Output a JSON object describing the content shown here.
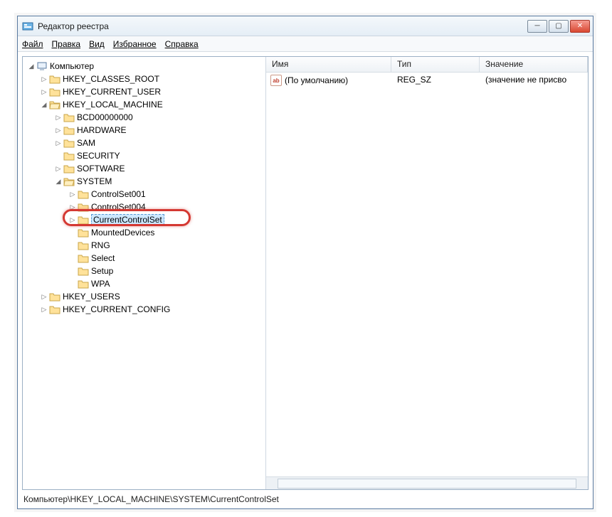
{
  "window": {
    "title": "Редактор реестра"
  },
  "menu": {
    "file": "Файл",
    "edit": "Правка",
    "view": "Вид",
    "favorites": "Избранное",
    "help": "Справка"
  },
  "tree": {
    "root": "Компьютер",
    "hkcr": "HKEY_CLASSES_ROOT",
    "hkcu": "HKEY_CURRENT_USER",
    "hklm": "HKEY_LOCAL_MACHINE",
    "hklm_children": {
      "bcd": "BCD00000000",
      "hardware": "HARDWARE",
      "sam": "SAM",
      "security": "SECURITY",
      "software": "SOFTWARE",
      "system": "SYSTEM"
    },
    "system_children": {
      "cs001": "ControlSet001",
      "cs004": "ControlSet004",
      "ccs": "CurrentControlSet",
      "mdev": "MountedDevices",
      "rng": "RNG",
      "select": "Select",
      "setup": "Setup",
      "wpa": "WPA"
    },
    "hku": "HKEY_USERS",
    "hkcc": "HKEY_CURRENT_CONFIG"
  },
  "list": {
    "columns": {
      "name": "Имя",
      "type": "Тип",
      "value": "Значение"
    },
    "row0": {
      "name": "(По умолчанию)",
      "type": "REG_SZ",
      "value": "(значение не присво"
    }
  },
  "status": {
    "path": "Компьютер\\HKEY_LOCAL_MACHINE\\SYSTEM\\CurrentControlSet"
  }
}
